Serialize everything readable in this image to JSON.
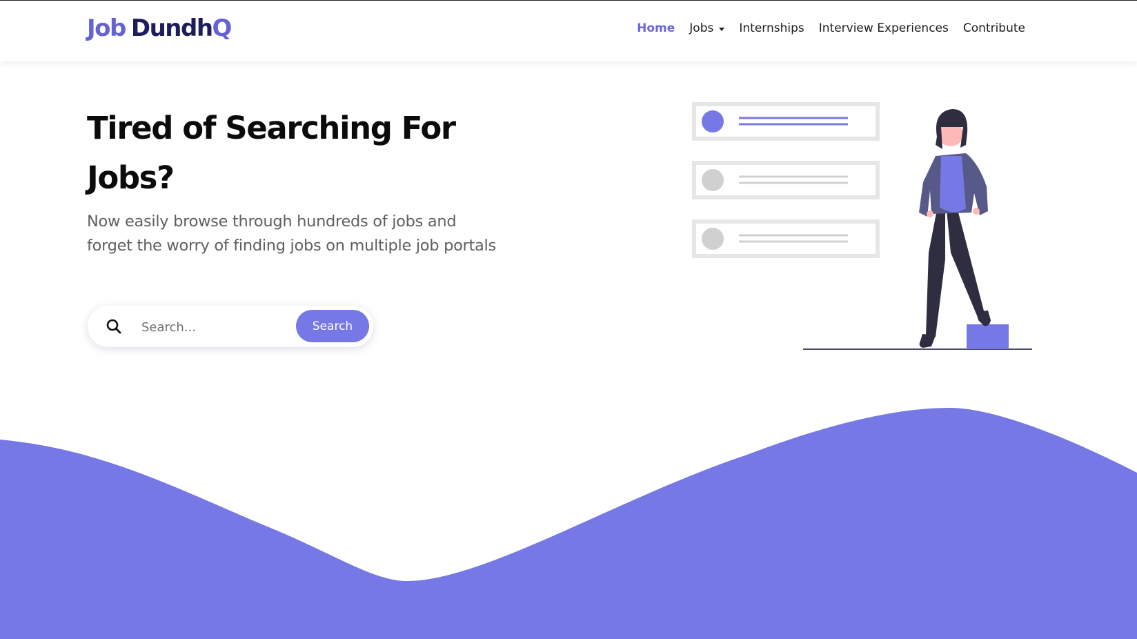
{
  "brand": {
    "logo_part1": "Job",
    "logo_part2": "Dundh",
    "logo_part3": "Q",
    "primary_color": "#7678e5",
    "navy_color": "#1e1c5c"
  },
  "nav": {
    "items": [
      {
        "label": "Home",
        "active": true
      },
      {
        "label": "Jobs",
        "dropdown": true
      },
      {
        "label": "Internships"
      },
      {
        "label": "Interview Experiences"
      },
      {
        "label": "Contribute"
      }
    ],
    "active_color": "#6a67d9"
  },
  "hero": {
    "title": "Tired of Searching For Jobs?",
    "subtitle": "Now easily browse through hundreds of jobs and forget the worry of finding jobs on multiple job portals"
  },
  "search": {
    "placeholder": "Search...",
    "button_label": "Search",
    "icon": "search-icon"
  },
  "illustration": {
    "icon": "woman-standing-with-list-illustration",
    "list_cards": 3
  }
}
